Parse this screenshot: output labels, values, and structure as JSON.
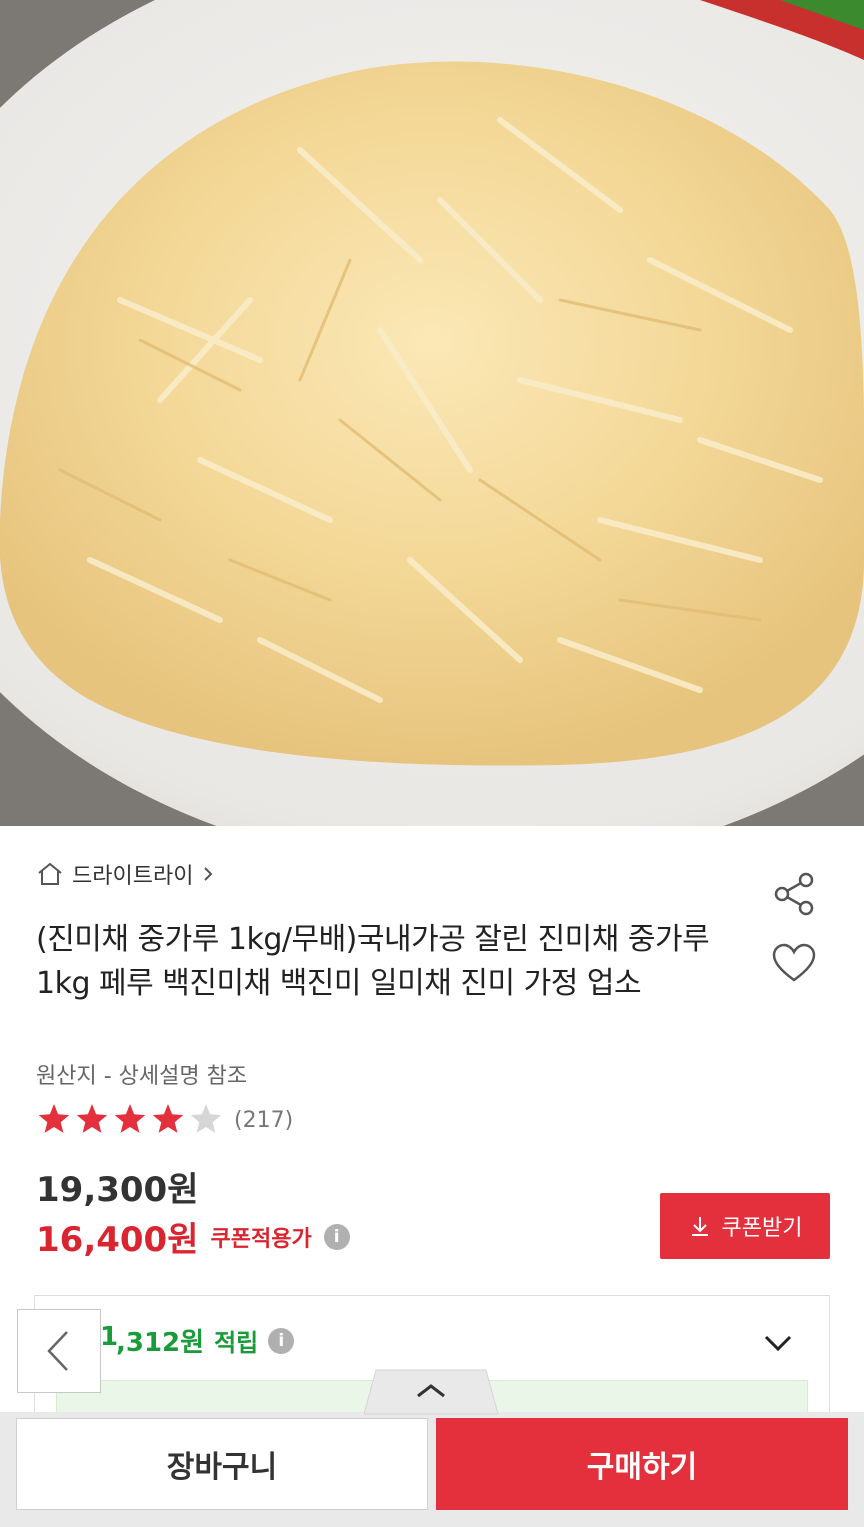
{
  "product": {
    "store_name": "드라이트라이",
    "title": "(진미채 중가루 1kg/무배)국내가공 잘린 진미채 중가루1kg 페루 백진미채 백진미 일미채 진미 가정 업소",
    "origin": "원산지 - 상세설명 참조",
    "rating": {
      "stars": 4,
      "max_stars": 5,
      "review_count": "(217)"
    },
    "original_price": "19,300원",
    "sale_price": "16,400원",
    "coupon_price_label": "쿠폰적용가",
    "info_glyph": "i"
  },
  "coupon_button": {
    "label": "쿠폰받기",
    "icon": "download-icon"
  },
  "points": {
    "lead": "1",
    "amount": ",312원",
    "label": "적립",
    "icon": "info-icon"
  },
  "bottom_bar": {
    "cart_label": "장바구니",
    "buy_label": "구매하기"
  },
  "colors": {
    "accent": "#e3303c",
    "points_green": "#1a9b3a",
    "star": "#e3303c"
  },
  "icons": [
    "home-icon",
    "chevron-right-icon",
    "share-icon",
    "heart-icon",
    "star-icon",
    "info-icon",
    "download-icon",
    "chevron-down-icon",
    "chevron-left-icon",
    "chevron-up-icon"
  ]
}
